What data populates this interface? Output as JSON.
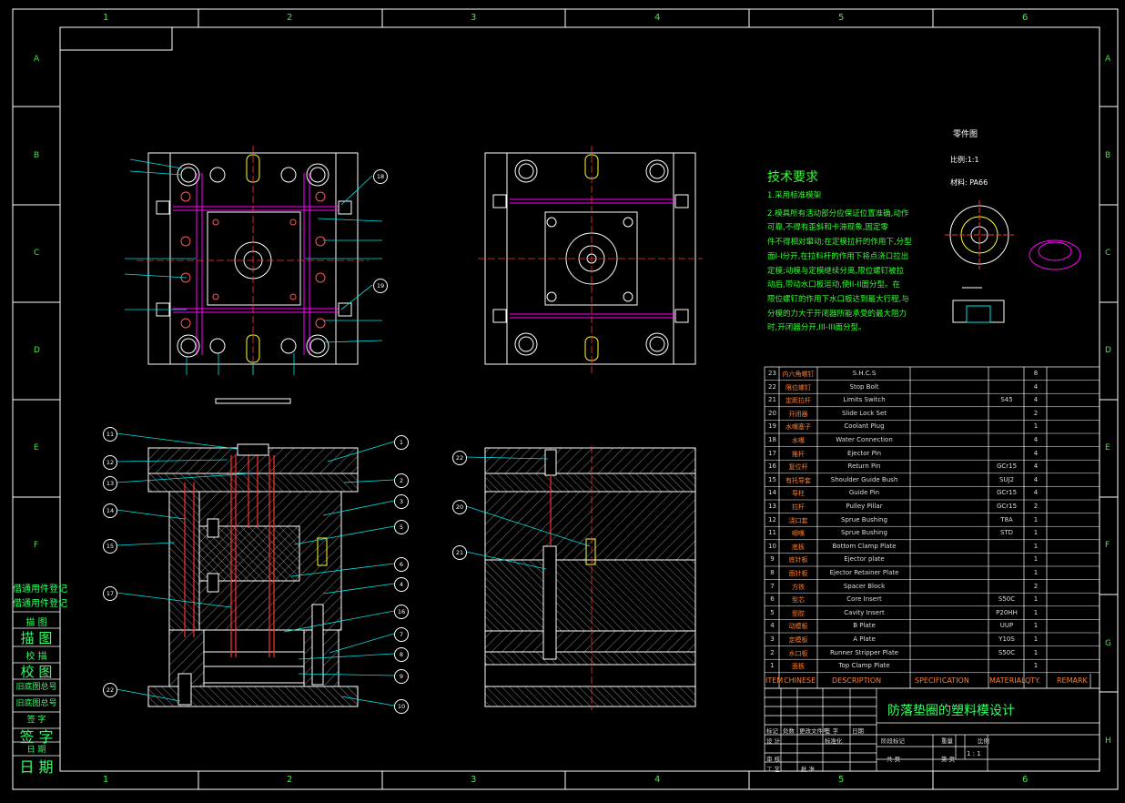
{
  "colors": {
    "frame": "#ffffff",
    "green": "#33ff33",
    "cyan": "#00e5e5",
    "magenta": "#ff00ff",
    "red": "#ff3333",
    "yellow": "#ffff33",
    "orange": "#ff7f2a"
  },
  "zones": {
    "columns": [
      "1",
      "2",
      "3",
      "4",
      "5",
      "6"
    ],
    "rows": [
      "A",
      "B",
      "C",
      "D",
      "E",
      "F",
      "G",
      "H"
    ]
  },
  "tech_requirements": {
    "title": "技术要求",
    "lines": [
      "1.采用标准模架",
      "2.模具所有活动部分应保证位置准确,动作",
      "可靠,不得有歪斜和卡滞现象,固定零",
      "件不得相对窜动;在定模拉杆的作用下,分型",
      "面I-I分开,在拉料杆的作用下将点浇口拉出",
      "定模;动模与定模继续分离,限位螺钉被拉",
      "动后,带动水口板运动,使II-II面分型。在",
      "限位螺钉的作用下水口板达到最大行程,与",
      "分模的力大于开闭器所能承受的最大阻力",
      "时,开闭器分开,III-III面分型。"
    ]
  },
  "part_drawing": {
    "title": "零件图",
    "scale": "比例:1:1",
    "material": "材料: PA66"
  },
  "leaders_left": [
    "11",
    "12",
    "13",
    "14",
    "15",
    "17",
    "22"
  ],
  "leaders_right": [
    "1",
    "2",
    "3",
    "5",
    "6",
    "4",
    "16",
    "7",
    "8",
    "9",
    "10"
  ],
  "leaders_top": [
    "18",
    "19"
  ],
  "leaders_mid": [
    "22",
    "20",
    "21"
  ],
  "bom": {
    "rows": [
      {
        "no": "23",
        "cn": "内六角螺钉",
        "en": "S.H.C.S",
        "spec": "",
        "mat": "",
        "qty": "8"
      },
      {
        "no": "22",
        "cn": "限位螺钉",
        "en": "Stop Bolt",
        "spec": "",
        "mat": "",
        "qty": "4"
      },
      {
        "no": "21",
        "cn": "定距拉杆",
        "en": "Limits Switch",
        "spec": "",
        "mat": "S45",
        "qty": "4"
      },
      {
        "no": "20",
        "cn": "开闭器",
        "en": "Slide Lock Set",
        "spec": "",
        "mat": "",
        "qty": "2"
      },
      {
        "no": "19",
        "cn": "水嘴塞子",
        "en": "Coolant Plug",
        "spec": "",
        "mat": "",
        "qty": "1"
      },
      {
        "no": "18",
        "cn": "水嘴",
        "en": "Water Connection",
        "spec": "",
        "mat": "",
        "qty": "4"
      },
      {
        "no": "17",
        "cn": "推杆",
        "en": "Ejector Pin",
        "spec": "",
        "mat": "",
        "qty": "4"
      },
      {
        "no": "16",
        "cn": "复位杆",
        "en": "Return Pin",
        "spec": "",
        "mat": "GCr15",
        "qty": "4"
      },
      {
        "no": "15",
        "cn": "有托导套",
        "en": "Shoulder Guide Bush",
        "spec": "",
        "mat": "SUJ2",
        "qty": "4"
      },
      {
        "no": "14",
        "cn": "导柱",
        "en": "Guide Pin",
        "spec": "",
        "mat": "GCr15",
        "qty": "4"
      },
      {
        "no": "13",
        "cn": "拉杆",
        "en": "Pulley Pillar",
        "spec": "",
        "mat": "GCr15",
        "qty": "2"
      },
      {
        "no": "12",
        "cn": "浇口套",
        "en": "Sprue Bushing",
        "spec": "",
        "mat": "T8A",
        "qty": "1"
      },
      {
        "no": "11",
        "cn": "唧嘴",
        "en": "Sprue Bushing",
        "spec": "",
        "mat": "STD",
        "qty": "1"
      },
      {
        "no": "10",
        "cn": "底板",
        "en": "Bottom Clamp Plate",
        "spec": "",
        "mat": "",
        "qty": "1"
      },
      {
        "no": "9",
        "cn": "底针板",
        "en": "Ejector plate",
        "spec": "",
        "mat": "",
        "qty": "1"
      },
      {
        "no": "8",
        "cn": "面针板",
        "en": "Ejector Retainer Plate",
        "spec": "",
        "mat": "",
        "qty": "1"
      },
      {
        "no": "7",
        "cn": "方铁",
        "en": "Spacer Block",
        "spec": "",
        "mat": "",
        "qty": "2"
      },
      {
        "no": "6",
        "cn": "型芯",
        "en": "Core Insert",
        "spec": "",
        "mat": "S50C",
        "qty": "1"
      },
      {
        "no": "5",
        "cn": "型腔",
        "en": "Cavity Insert",
        "spec": "",
        "mat": "P20HH",
        "qty": "1"
      },
      {
        "no": "4",
        "cn": "动模板",
        "en": "B Plate",
        "spec": "",
        "mat": "UUP",
        "qty": "1"
      },
      {
        "no": "3",
        "cn": "定模板",
        "en": "A Plate",
        "spec": "",
        "mat": "Y10S",
        "qty": "1"
      },
      {
        "no": "2",
        "cn": "水口板",
        "en": "Runner Stripper Plate",
        "spec": "",
        "mat": "S50C",
        "qty": "1"
      },
      {
        "no": "1",
        "cn": "面板",
        "en": "Top Clamp Plate",
        "spec": "",
        "mat": "",
        "qty": "1"
      }
    ],
    "header": {
      "item": "ITEM",
      "cn": "CHINESE",
      "desc": "DESCRIPTION",
      "spec": "SPECIFICATION",
      "mat": "MATERIAL",
      "qty": "QTY.",
      "remark": "REMARK"
    }
  },
  "title_block": {
    "drawing_title": "防落垫圈的塑料模设计",
    "row_a": [
      "标记",
      "处数",
      "更改文件号",
      "签 字",
      "日期"
    ],
    "row_b": [
      "设 计",
      "标准化",
      "阶段标记",
      "重量",
      "比例"
    ],
    "scale_value": "1 : 1",
    "row_c": [
      "审 核",
      "",
      "共 页",
      "第 页"
    ],
    "row_d": [
      "工 艺",
      "批 准"
    ]
  },
  "side_stamp": {
    "lines": [
      "借通用件登记",
      "描 图",
      "校 描",
      "校 图",
      "旧底图总号",
      "旧底图总号",
      "签 字",
      "签 字",
      "日 期",
      "日 期"
    ]
  }
}
